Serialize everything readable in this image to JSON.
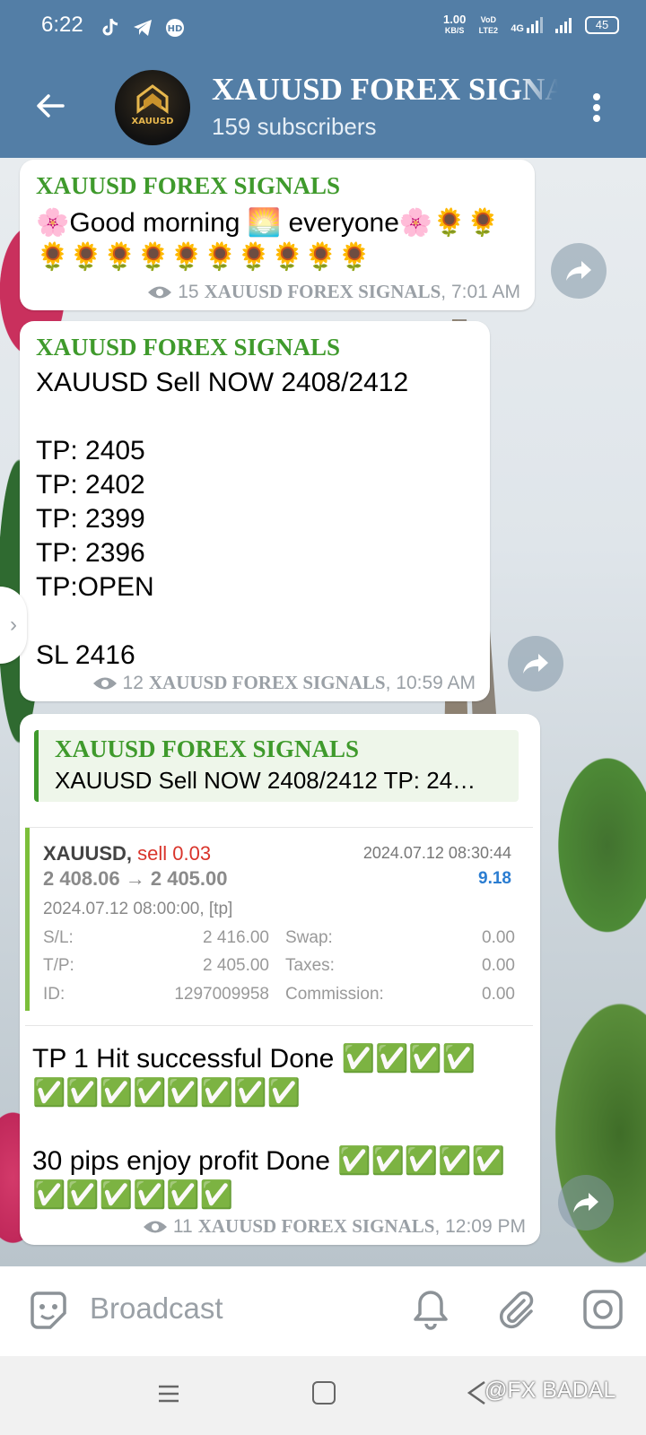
{
  "status_bar": {
    "time": "6:22",
    "speed_value": "1.00",
    "speed_unit": "KB/S",
    "volte": "VoD LTE2",
    "network": "4G",
    "battery": "45"
  },
  "header": {
    "title": "XAUUSD FOREX SIGNALS",
    "subtitle": "159 subscribers",
    "avatar_text": "XAUUSD"
  },
  "messages": [
    {
      "sender": "XAUUSD FOREX SIGNALS",
      "text": "🌸Good morning 🌅 everyone🌸🌻🌻\n🌻🌻🌻🌻🌻🌻🌻🌻🌻🌻",
      "views": "15",
      "signature": "XAUUSD FOREX SIGNALS",
      "time": ", 7:01 AM"
    },
    {
      "sender": "XAUUSD FOREX SIGNALS",
      "text": "XAUUSD Sell NOW  2408/2412\n\nTP: 2405\nTP: 2402\nTP: 2399\nTP: 2396\nTP:OPEN\n\nSL 2416",
      "views": "12",
      "signature": "XAUUSD FOREX SIGNALS",
      "time": ", 10:59 AM"
    },
    {
      "reply_sender": "XAUUSD FOREX SIGNALS",
      "reply_text": "XAUUSD Sell NOW  2408/2412  TP: 24…",
      "trade": {
        "symbol": "XAUUSD,",
        "side": " sell 0.03",
        "date": "2024.07.12 08:30:44",
        "prices": "2 408.06 → 2 405.00",
        "profit": "9.18",
        "open_info": "2024.07.12 08:00:00, [tp]",
        "sl_label": "S/L:",
        "sl_value": "2 416.00",
        "tp_label": "T/P:",
        "tp_value": "2 405.00",
        "id_label": "ID:",
        "id_value": "1297009958",
        "swap_label": "Swap:",
        "swap_value": "0.00",
        "taxes_label": "Taxes:",
        "taxes_value": "0.00",
        "commission_label": "Commission:",
        "commission_value": "0.00"
      },
      "text": "TP 1 Hit successful Done ✅✅✅✅\n✅✅✅✅✅✅✅✅\n\n30 pips enjoy profit Done ✅✅✅✅✅\n✅✅✅✅✅✅",
      "views": "11",
      "signature": "XAUUSD FOREX SIGNALS",
      "time": ", 12:09 PM"
    }
  ],
  "input_bar": {
    "placeholder": "Broadcast"
  },
  "watermark": "@FX BADAL",
  "colors": {
    "header_bg": "#537ea6",
    "sender_green": "#3f9a2c",
    "profit_blue": "#2b7dd1",
    "sell_red": "#d9342b"
  }
}
